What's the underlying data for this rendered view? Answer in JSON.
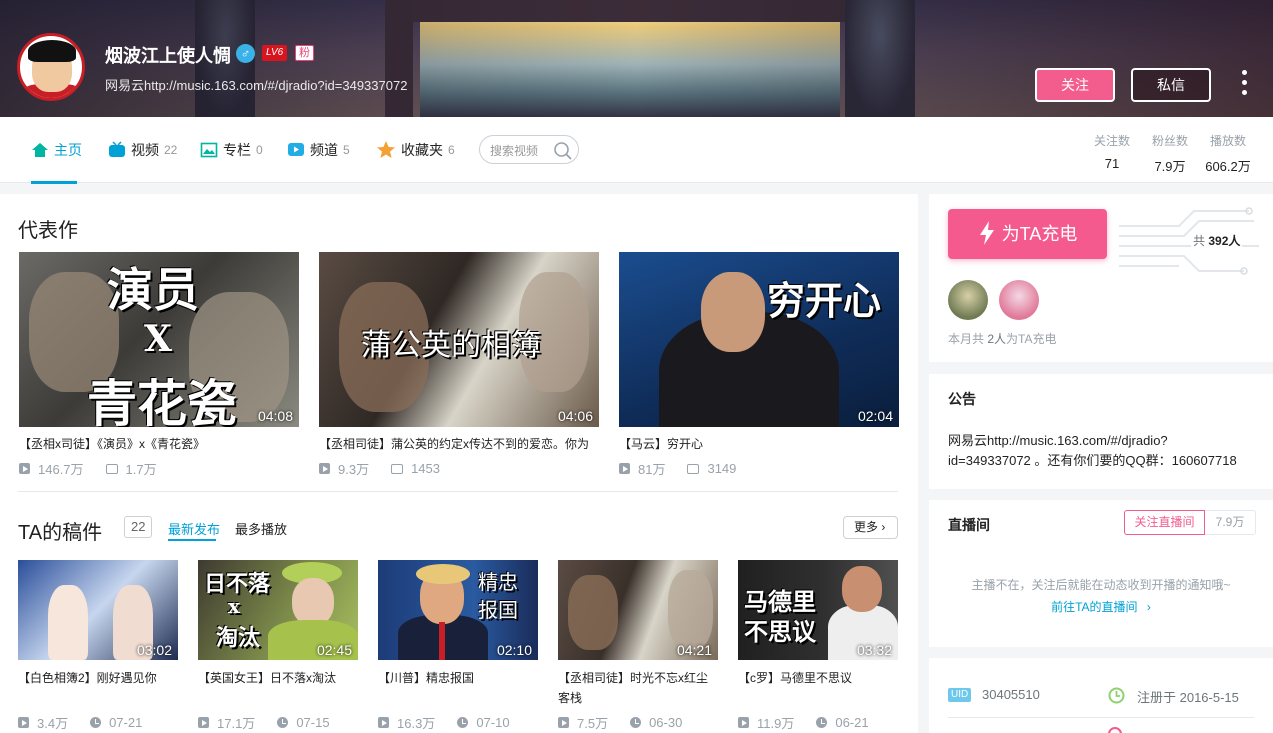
{
  "header": {
    "username": "烟波江上使人惆",
    "level": "LV6",
    "fan_badge": "粉",
    "sign": "网易云http://music.163.com/#/djradio?id=349337072",
    "follow_label": "关注",
    "message_label": "私信"
  },
  "nav": {
    "tabs": [
      {
        "label": "主页",
        "count": ""
      },
      {
        "label": "视频",
        "count": "22"
      },
      {
        "label": "专栏",
        "count": "0"
      },
      {
        "label": "频道",
        "count": "5"
      },
      {
        "label": "收藏夹",
        "count": "6"
      }
    ],
    "search_placeholder": "搜索视频",
    "stats": [
      {
        "label": "关注数",
        "value": "71"
      },
      {
        "label": "粉丝数",
        "value": "7.9万"
      },
      {
        "label": "播放数",
        "value": "606.2万"
      }
    ]
  },
  "masterpiece": {
    "title": "代表作",
    "videos": [
      {
        "cover_text": [
          "演员",
          "X",
          "青花瓷"
        ],
        "duration": "04:08",
        "title": "【丞相x司徒】《演员》x《青花瓷》",
        "plays": "146.7万",
        "danmaku": "1.7万"
      },
      {
        "cover_text": [
          "蒲公英的相簿"
        ],
        "duration": "04:06",
        "title": "【丞相司徒】蒲公英的约定x传达不到的爱恋。你为",
        "plays": "9.3万",
        "danmaku": "1453"
      },
      {
        "cover_text": [
          "穷开心"
        ],
        "duration": "02:04",
        "title": "【马云】穷开心",
        "plays": "81万",
        "danmaku": "3149"
      }
    ]
  },
  "uploads": {
    "title": "TA的稿件",
    "count": "22",
    "tab_latest": "最新发布",
    "tab_most": "最多播放",
    "more": "更多",
    "videos": [
      {
        "cover_text": [],
        "duration": "03:02",
        "title": "【白色相簿2】刚好遇见你",
        "plays": "3.4万",
        "date": "07-21"
      },
      {
        "cover_text": [
          "日不落",
          "x",
          "淘汰"
        ],
        "duration": "02:45",
        "title": "【英国女王】日不落x淘汰",
        "plays": "17.1万",
        "date": "07-15"
      },
      {
        "cover_text": [
          "精忠",
          "报国"
        ],
        "duration": "02:10",
        "title": "【川普】精忠报国",
        "plays": "16.3万",
        "date": "07-10"
      },
      {
        "cover_text": [],
        "duration": "04:21",
        "title": "【丞相司徒】时光不忘x红尘客栈",
        "plays": "7.5万",
        "date": "06-30"
      },
      {
        "cover_text": [
          "马德里",
          "不思议"
        ],
        "duration": "03:32",
        "title": "【c罗】马德里不思议",
        "plays": "11.9万",
        "date": "06-21"
      }
    ]
  },
  "sidebar": {
    "charge_label": "为TA充电",
    "total_prefix": "共",
    "total_count": "392人",
    "month_text_prefix": "本月共",
    "month_count": "2人",
    "month_text_suffix": "为TA充电",
    "notice_title": "公告",
    "notice_line1": "网易云http://music.163.com/#/djradio?",
    "notice_line2": "id=349337072 。还有你们要的QQ群：160607718",
    "live_title": "直播间",
    "live_follow": "关注直播间",
    "live_fans": "7.9万",
    "live_status": "主播不在，关注后就能在动态收到开播的通知哦~",
    "live_link": "前往TA的直播间",
    "uid_badge": "UID",
    "uid": "30405510",
    "register": "注册于 2016-5-15"
  },
  "colors": {
    "accent": "#00a1d6",
    "pink": "#f25d8e",
    "meta": "#99a2aa"
  }
}
